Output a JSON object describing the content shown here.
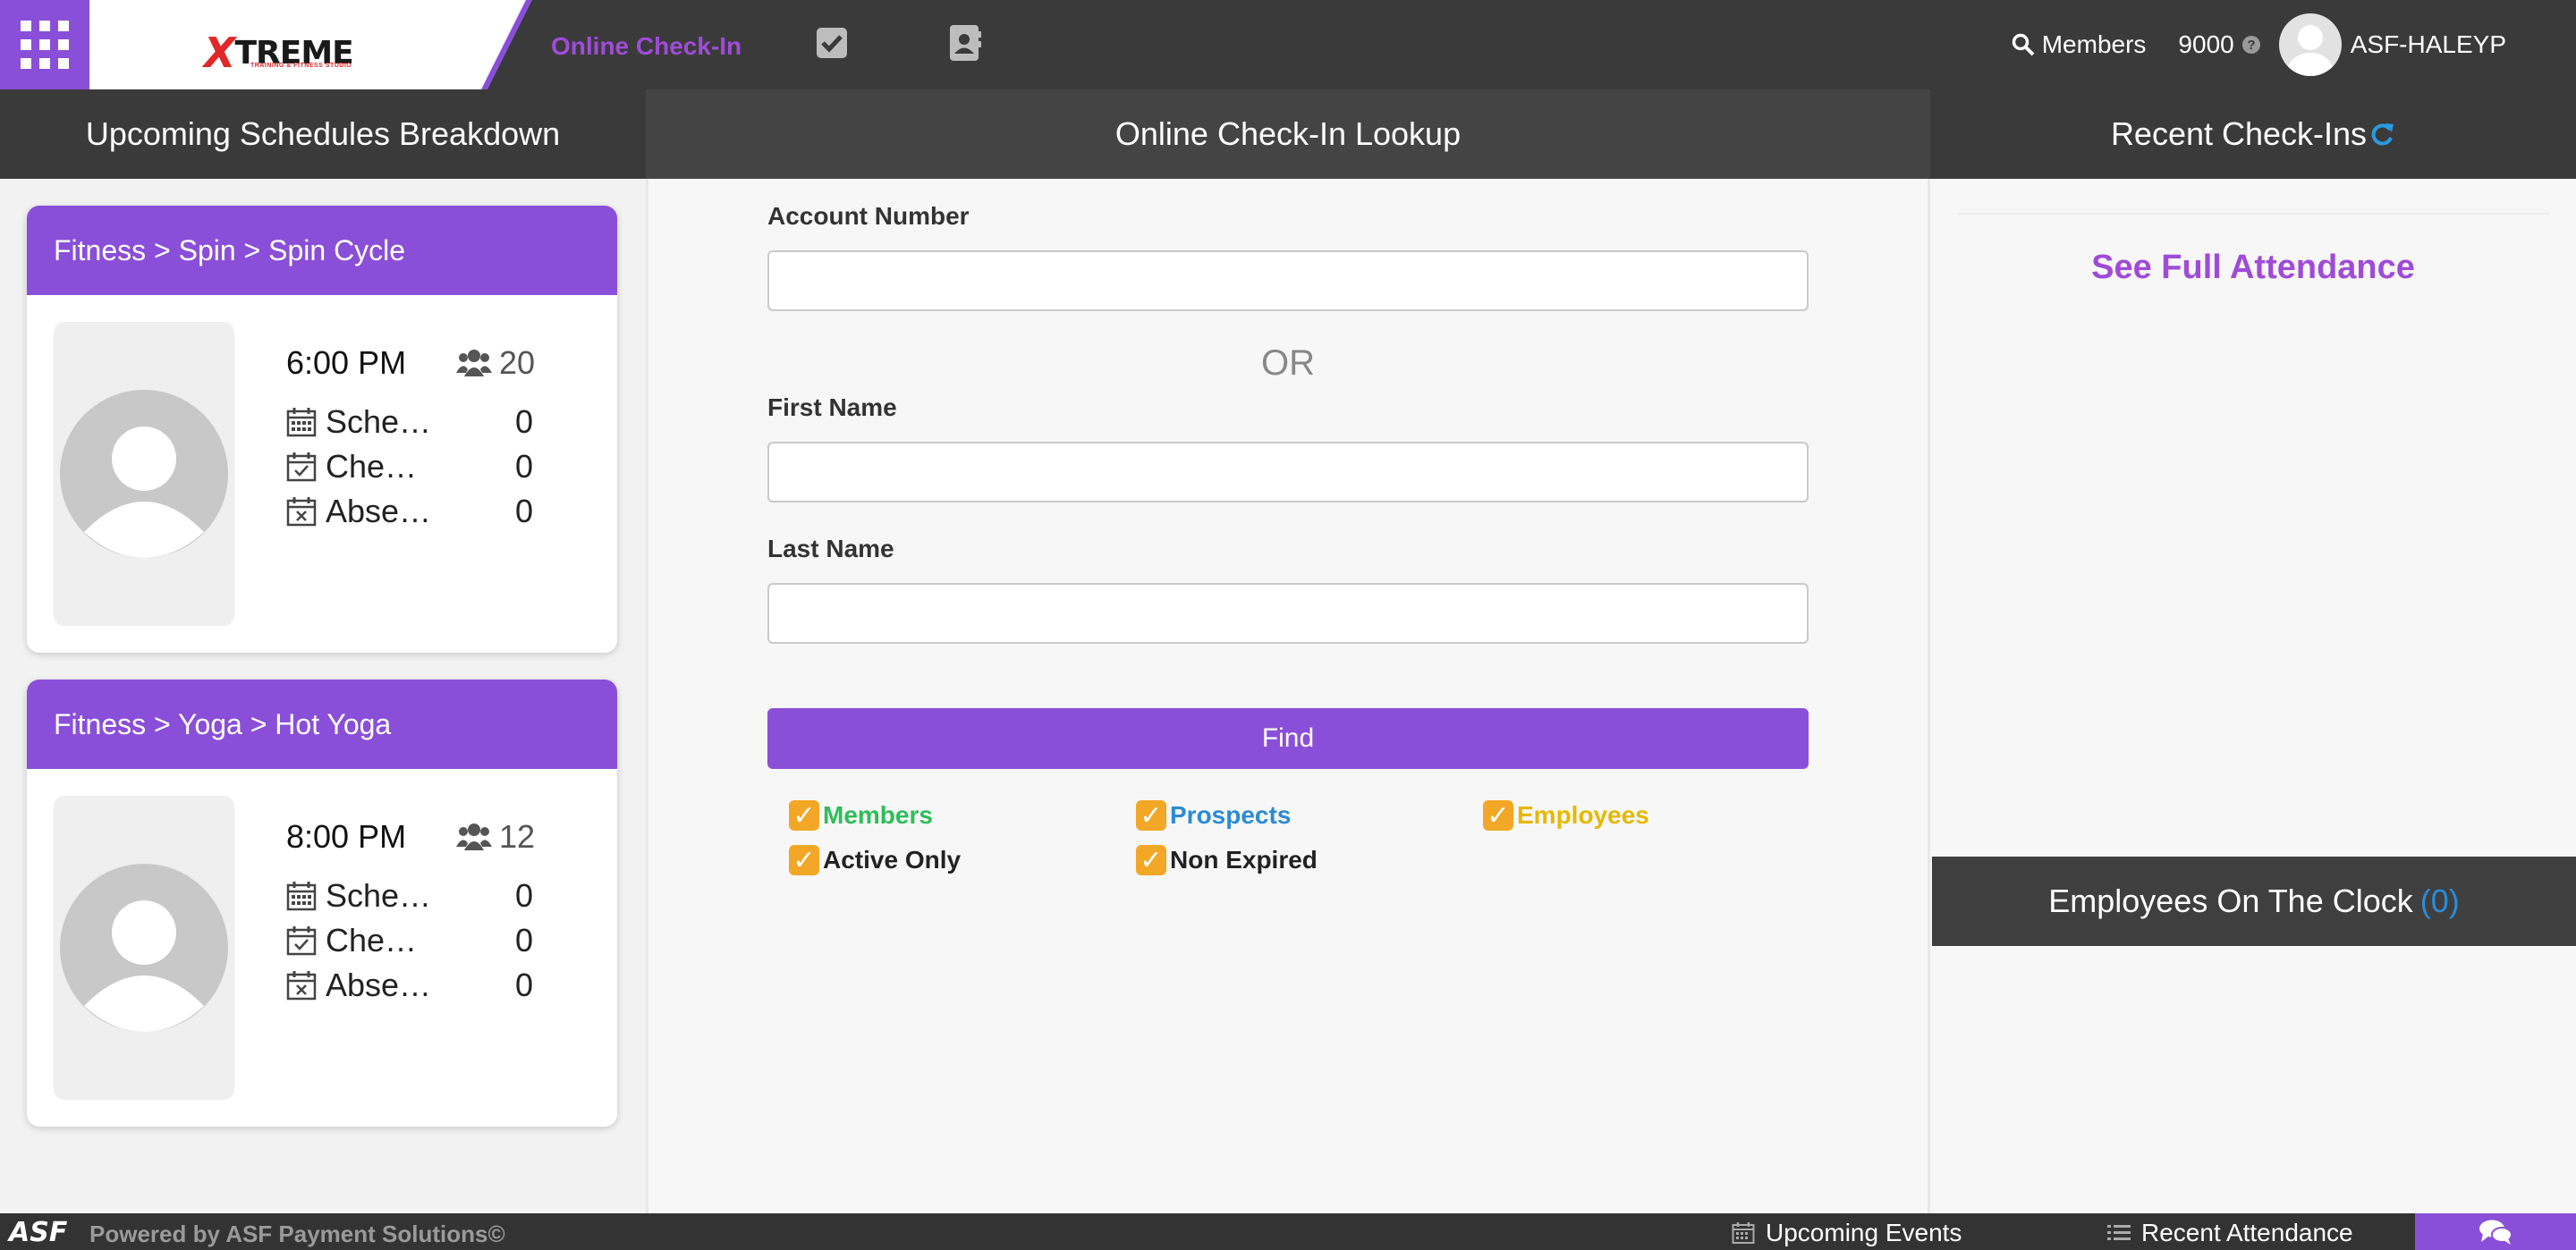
{
  "colors": {
    "accent": "#8a4fd8",
    "accent_text": "#a04bd8",
    "nav_bg": "#3a3a3a",
    "checkbox": "#f3a726",
    "members": "#2ebd59",
    "prospects": "#2a8bd6",
    "employees": "#e6b800",
    "refresh": "#2a9be0"
  },
  "topnav": {
    "menu_icon": "grid-icon",
    "logo": {
      "main": "TREME",
      "initial": "X",
      "sub": "TRAINING & FITNESS STUDIO"
    },
    "title": "Online Check-In",
    "icons": [
      "check-square-icon",
      "contact-book-icon"
    ],
    "members_label": "Members",
    "location_number": "9000",
    "help_icon": "question-circle-icon",
    "username": "ASF-HALEYP"
  },
  "left_panel": {
    "title": "Upcoming Schedules Breakdown",
    "schedules": [
      {
        "title": "Fitness > Spin > Spin Cycle",
        "time": "6:00 PM",
        "capacity": "20",
        "stats": [
          {
            "label": "Scheduled",
            "display": "Sche…",
            "value": "0"
          },
          {
            "label": "Checked In",
            "display": "Che…",
            "value": "0"
          },
          {
            "label": "Absent",
            "display": "Abse…",
            "value": "0"
          }
        ]
      },
      {
        "title": "Fitness > Yoga > Hot Yoga",
        "time": "8:00 PM",
        "capacity": "12",
        "stats": [
          {
            "label": "Scheduled",
            "display": "Sche…",
            "value": "0"
          },
          {
            "label": "Checked In",
            "display": "Che…",
            "value": "0"
          },
          {
            "label": "Absent",
            "display": "Abse…",
            "value": "0"
          }
        ]
      }
    ]
  },
  "center_panel": {
    "title": "Online Check-In Lookup",
    "account_label": "Account Number",
    "account_value": "",
    "or_text": "OR",
    "first_name_label": "First Name",
    "first_name_value": "",
    "last_name_label": "Last Name",
    "last_name_value": "",
    "find_label": "Find",
    "filters": [
      {
        "label": "Members",
        "checked": true,
        "color": "#2ebd59"
      },
      {
        "label": "Prospects",
        "checked": true,
        "color": "#2a8bd6"
      },
      {
        "label": "Employees",
        "checked": true,
        "color": "#e6b800"
      },
      {
        "label": "Active Only",
        "checked": true,
        "color": "#222222"
      },
      {
        "label": "Non Expired",
        "checked": true,
        "color": "#222222"
      }
    ]
  },
  "right_panel": {
    "title": "Recent Check-Ins",
    "refresh_icon": "refresh-icon",
    "see_full_label": "See Full Attendance",
    "employees_title": "Employees On The Clock",
    "employees_count": "(0)"
  },
  "footer": {
    "brand": "ASF",
    "powered": "Powered by ASF Payment Solutions©",
    "upcoming_events": "Upcoming Events",
    "recent_attendance": "Recent Attendance",
    "chat_icon": "chat-icon"
  }
}
